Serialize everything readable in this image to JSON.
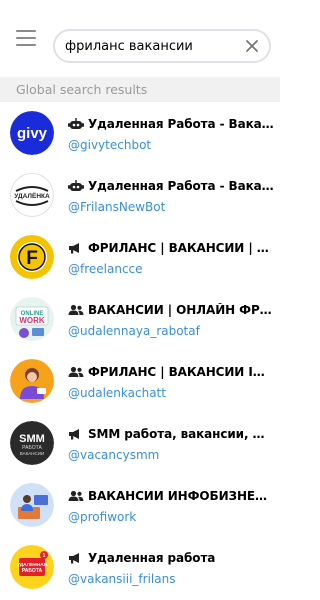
{
  "search": {
    "value": "фриланс вакансии"
  },
  "section_header": "Global search results",
  "results": [
    {
      "type_icon": "bot-icon",
      "title": "Удаленная Работа - Вакансии, Фриланс",
      "username": "@givytechbot",
      "avatar_text": "givy",
      "avatar_color": "#1a2bd9"
    },
    {
      "type_icon": "bot-icon",
      "title": "Удаленная Работа - Вакансии, Фриланс",
      "username": "@FrilansNewBot",
      "avatar_text": "УДАЛЁНКА",
      "avatar_color": "#ffffff"
    },
    {
      "type_icon": "channel-icon",
      "title": "ФРИЛАНС | ВАКАНСИИ | УДАЛЕНКА",
      "username": "@freelancce",
      "avatar_text": "F",
      "avatar_color": "#f5c400"
    },
    {
      "type_icon": "group-icon",
      "title": "ВАКАНСИИ | ОНЛАЙН ФРИЛАНС",
      "username": "@udalennaya_rabotaf",
      "avatar_text": "ONLINE WORK",
      "avatar_color": "#e6f3ee"
    },
    {
      "type_icon": "group-icon",
      "title": "ФРИЛАНС | ВАКАНСИИ INSTAGRAM",
      "username": "@udalenkachatt",
      "avatar_text": "",
      "avatar_color": "#f6a21a"
    },
    {
      "type_icon": "channel-icon",
      "title": "SMM работа, вакансии, фриланс",
      "username": "@vacancysmm",
      "avatar_text": "SMM РАБОТА ВАКАНСИИ",
      "avatar_color": "#2a2a2a"
    },
    {
      "type_icon": "group-icon",
      "title": "ВАКАНСИИ ИНФОБИЗНЕС | ФРИЛАНС",
      "username": "@profiwork",
      "avatar_text": "",
      "avatar_color": "#cfe0f7"
    },
    {
      "type_icon": "channel-icon",
      "title": "Удаленная работа",
      "username": "@vakansiii_frilans",
      "avatar_text": "УДАЛЕННАЯ РАБОТА",
      "avatar_color": "#ffd21c"
    }
  ]
}
